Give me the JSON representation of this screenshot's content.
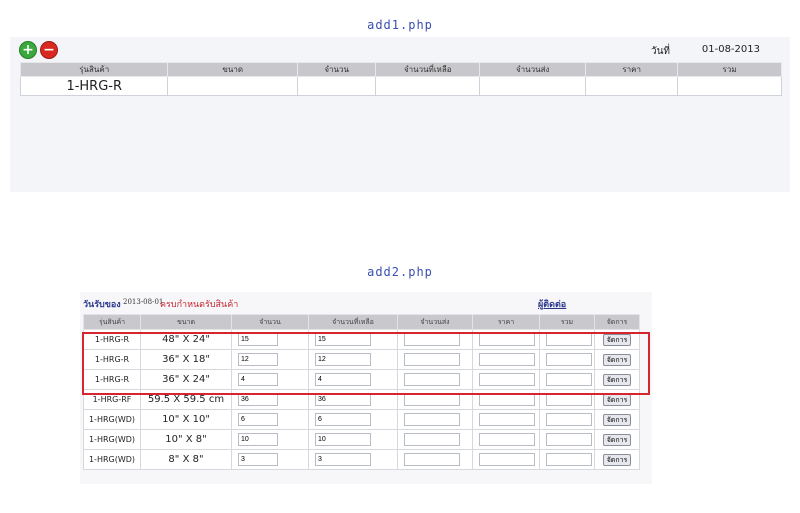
{
  "add1": {
    "caption": "add1.php",
    "add_icon": "plus-circle-icon",
    "remove_icon": "minus-circle-icon",
    "date_label": "วันที่",
    "date_value": "01-08-2013",
    "headers": [
      "รุ่นสินค้า",
      "ขนาด",
      "จำนวน",
      "จำนวนที่เหลือ",
      "จำนวนส่ง",
      "ราคา",
      "รวม"
    ],
    "row": {
      "model": "1-HRG-R"
    }
  },
  "add2": {
    "caption": "add2.php",
    "recv_label": "วันรับของ",
    "recv_date": "2013-08-01",
    "complete_text": "ครบกำหนดรับสินค้า",
    "contact_label": "ผู้ติดต่อ",
    "headers": [
      "รุ่นสินค้า",
      "ขนาด",
      "จำนวน",
      "จำนวนที่เหลือ",
      "จำนวนส่ง",
      "ราคา",
      "รวม",
      "จัดการ"
    ],
    "manage_label": "จัดการ",
    "rows": [
      {
        "model": "1-HRG-R",
        "size": "48\" X 24\"",
        "qty": "15",
        "remain": "15"
      },
      {
        "model": "1-HRG-R",
        "size": "36\" X 18\"",
        "qty": "12",
        "remain": "12"
      },
      {
        "model": "1-HRG-R",
        "size": "36\" X 24\"",
        "qty": "4",
        "remain": "4"
      },
      {
        "model": "1-HRG-RF",
        "size": "59.5 X 59.5 cm",
        "qty": "36",
        "remain": "36"
      },
      {
        "model": "1-HRG(WD)",
        "size": "10\" X 10\"",
        "qty": "6",
        "remain": "6"
      },
      {
        "model": "1-HRG(WD)",
        "size": "10\" X 8\"",
        "qty": "10",
        "remain": "10"
      },
      {
        "model": "1-HRG(WD)",
        "size": "8\" X 8\"",
        "qty": "3",
        "remain": "3"
      }
    ],
    "highlight_color": "#d6252e"
  }
}
